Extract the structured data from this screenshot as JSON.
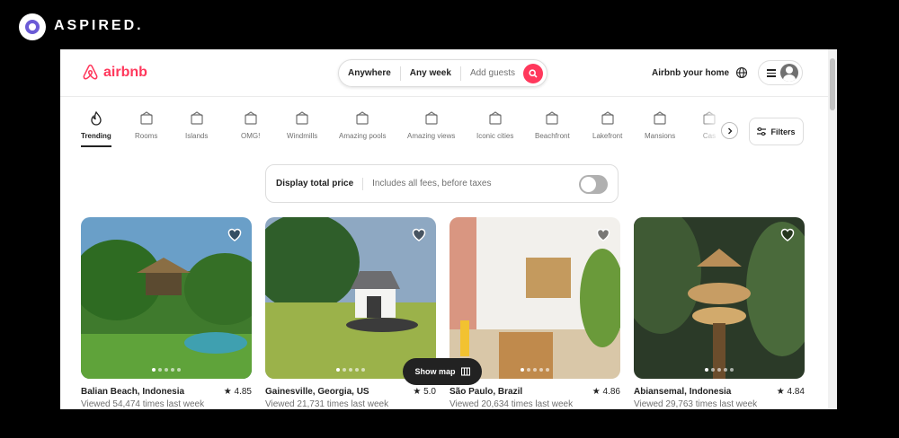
{
  "brand": {
    "name": "ASPIRED."
  },
  "header": {
    "logo_text": "airbnb",
    "search": {
      "where": "Anywhere",
      "when": "Any week",
      "guests_placeholder": "Add guests"
    },
    "host_link": "Airbnb your home"
  },
  "categories": [
    {
      "label": "Trending",
      "icon": "trending-icon",
      "active": true
    },
    {
      "label": "Rooms",
      "icon": "bed-icon"
    },
    {
      "label": "Islands",
      "icon": "island-icon"
    },
    {
      "label": "OMG!",
      "icon": "ufo-house-icon"
    },
    {
      "label": "Windmills",
      "icon": "windmill-icon"
    },
    {
      "label": "Amazing pools",
      "icon": "pool-icon"
    },
    {
      "label": "Amazing views",
      "icon": "view-icon"
    },
    {
      "label": "Iconic cities",
      "icon": "city-icon"
    },
    {
      "label": "Beachfront",
      "icon": "beach-icon"
    },
    {
      "label": "Lakefront",
      "icon": "lake-icon"
    },
    {
      "label": "Mansions",
      "icon": "mansion-icon"
    },
    {
      "label": "Cas",
      "icon": "castle-icon"
    }
  ],
  "filters_label": "Filters",
  "price_toggle": {
    "label": "Display total price",
    "detail": "Includes all fees, before taxes"
  },
  "listings": [
    {
      "location": "Balian Beach, Indonesia",
      "rating": "★ 4.85",
      "views": "Viewed 54,474 times last week"
    },
    {
      "location": "Gainesville, Georgia, US",
      "rating": "★ 5.0",
      "views": "Viewed 21,731 times last week"
    },
    {
      "location": "São Paulo, Brazil",
      "rating": "★ 4.86",
      "views": "Viewed 20,634 times last week"
    },
    {
      "location": "Abiansemal, Indonesia",
      "rating": "★ 4.84",
      "views": "Viewed 29,763 times last week"
    }
  ],
  "show_map_label": "Show map",
  "colors": {
    "accent": "#ff385c",
    "text": "#222222",
    "muted": "#717171"
  }
}
